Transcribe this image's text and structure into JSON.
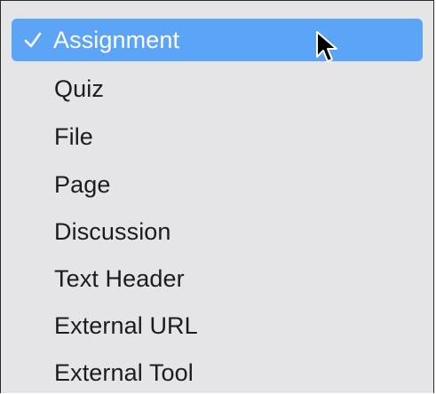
{
  "menu": {
    "items": [
      {
        "label": "Assignment",
        "selected": true
      },
      {
        "label": "Quiz",
        "selected": false
      },
      {
        "label": "File",
        "selected": false
      },
      {
        "label": "Page",
        "selected": false
      },
      {
        "label": "Discussion",
        "selected": false
      },
      {
        "label": "Text Header",
        "selected": false
      },
      {
        "label": "External URL",
        "selected": false
      },
      {
        "label": "External Tool",
        "selected": false
      }
    ],
    "selected_icon": "checkmark-icon"
  },
  "colors": {
    "menu_background": "#e5e5e7",
    "highlight": "#5ba4f6",
    "text": "#1c1c1e",
    "highlight_text": "#ffffff"
  },
  "cursor_icon": "arrow-cursor-icon"
}
